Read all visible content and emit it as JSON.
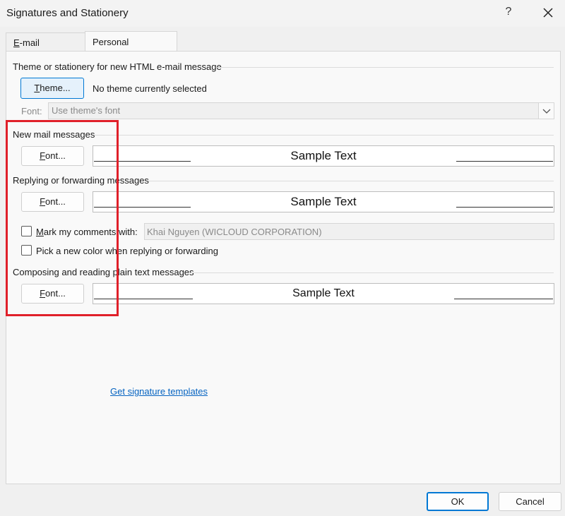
{
  "window": {
    "title": "Signatures and Stationery",
    "help_glyph": "?",
    "close_icon": "close-icon"
  },
  "tabs": [
    {
      "label_acc": "E",
      "label_rest": "-mail Signature"
    },
    {
      "label": "Personal Stationery"
    }
  ],
  "theme_section": {
    "heading": "Theme or stationery for new HTML e-mail message",
    "theme_button_acc": "T",
    "theme_button_rest": "heme...",
    "status": "No theme currently selected",
    "font_label": "Font:",
    "font_value": "Use theme's font"
  },
  "new_mail": {
    "heading": "New mail messages",
    "font_button_pre": "F",
    "font_button_rest": "ont...",
    "sample": "Sample Text"
  },
  "replying": {
    "heading": "Replying or forwarding messages",
    "font_button_pre": "F",
    "font_button_rest": "ont...",
    "sample": "Sample Text",
    "mark_comments_acc": "M",
    "mark_comments_rest": "ark my comments with:",
    "mark_comments_value": "Khai Nguyen (WICLOUD CORPORATION)",
    "pick_color_label": "Pick a new color when replying or forwarding"
  },
  "plain_text": {
    "heading": "Composing and reading plain text messages",
    "font_button_pre": "F",
    "font_button_rest": "ont...",
    "sample": "Sample Text"
  },
  "link": "Get signature templates",
  "footer": {
    "ok": "OK",
    "cancel": "Cancel"
  },
  "colors": {
    "highlight": "#e0202a",
    "accent": "#0078d4",
    "link": "#0563c1"
  }
}
